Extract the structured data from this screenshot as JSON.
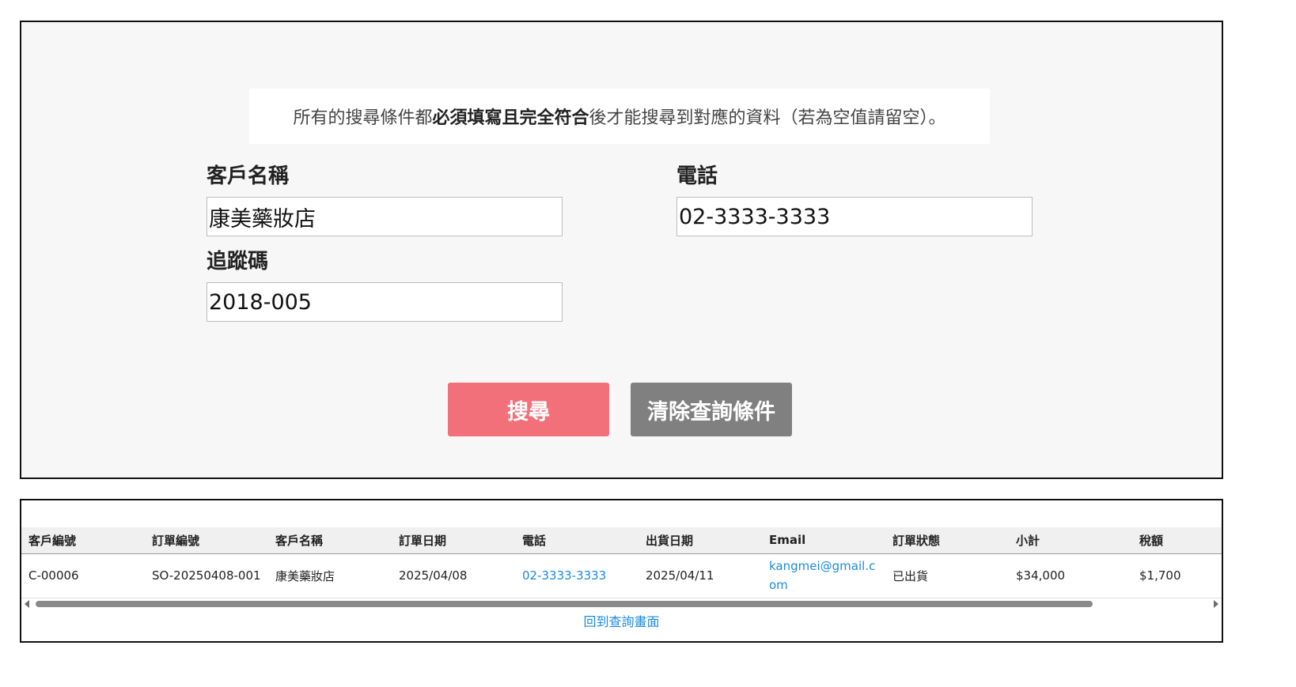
{
  "colors": {
    "search_button": "#f1707a",
    "clear_button": "#808080",
    "link": "#1a8ae0",
    "panel_bg": "#f7f7f7"
  },
  "search": {
    "notice_prefix": "所有的搜尋條件都",
    "notice_bold": "必須填寫且完全符合",
    "notice_suffix": "後才能搜尋到對應的資料（若為空值請留空）。",
    "customer_name_label": "客戶名稱",
    "customer_name_value": "康美藥妝店",
    "phone_label": "電話",
    "phone_value": "02-3333-3333",
    "tracking_label": "追蹤碼",
    "tracking_value": "2018-005",
    "search_button": "搜尋",
    "clear_button": "清除查詢條件"
  },
  "results": {
    "columns": [
      "客戶編號",
      "訂單編號",
      "客戶名稱",
      "訂單日期",
      "電話",
      "出貨日期",
      "Email",
      "訂單狀態",
      "小計",
      "稅額"
    ],
    "rows": [
      {
        "customer_id": "C-00006",
        "order_id": "SO-20250408-001",
        "customer_name": "康美藥妝店",
        "order_date": "2025/04/08",
        "phone": "02-3333-3333",
        "ship_date": "2025/04/11",
        "email": "kangmei@gmail.com",
        "status": "已出貨",
        "subtotal": "$34,000",
        "tax": "$1,700"
      }
    ],
    "back_link": "回到查詢畫面"
  }
}
